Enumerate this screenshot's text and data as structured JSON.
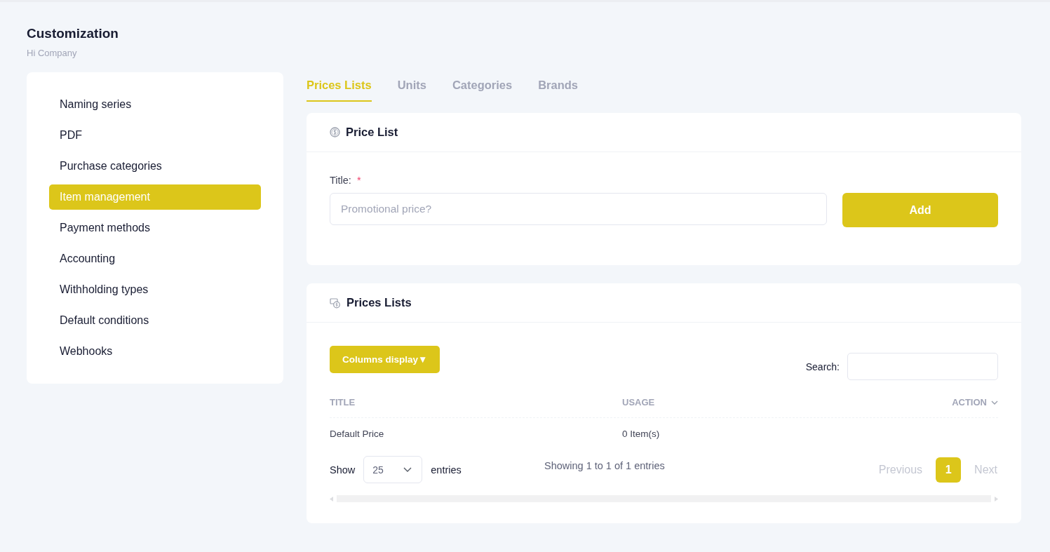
{
  "header": {
    "title": "Customization",
    "subtitle": "Hi Company"
  },
  "sidebar": {
    "items": [
      {
        "label": "Naming series",
        "selected": false
      },
      {
        "label": "PDF",
        "selected": false
      },
      {
        "label": "Purchase categories",
        "selected": false
      },
      {
        "label": "Item management",
        "selected": true
      },
      {
        "label": "Payment methods",
        "selected": false
      },
      {
        "label": "Accounting",
        "selected": false
      },
      {
        "label": "Withholding types",
        "selected": false
      },
      {
        "label": "Default conditions",
        "selected": false
      },
      {
        "label": "Webhooks",
        "selected": false
      }
    ]
  },
  "tabs": [
    {
      "label": "Prices Lists",
      "selected": true
    },
    {
      "label": "Units",
      "selected": false
    },
    {
      "label": "Categories",
      "selected": false
    },
    {
      "label": "Brands",
      "selected": false
    }
  ],
  "price_list_card": {
    "title": "Price List",
    "field": {
      "label": "Title:",
      "required_mark": "*",
      "placeholder": "Promotional price?"
    },
    "button": "Add"
  },
  "prices_lists_card": {
    "title": "Prices Lists",
    "columns_button": "Columns display▼",
    "search_label": "Search:",
    "table": {
      "columns": [
        {
          "label": "TITLE",
          "dropdown": false
        },
        {
          "label": "USAGE",
          "dropdown": false
        },
        {
          "label": "ACTION",
          "dropdown": true
        }
      ],
      "rows": [
        [
          "Default Price",
          "0 Item(s)"
        ]
      ]
    },
    "show_label": "Show",
    "page_size": "25",
    "entries_label": "entries",
    "info": "Showing 1 to 1 of 1 entries",
    "pagination": {
      "previous": {
        "label": "Previous",
        "disabled": true
      },
      "pages": [
        {
          "label": "1",
          "selected": true
        }
      ],
      "next": {
        "label": "Next",
        "disabled": true
      }
    }
  }
}
